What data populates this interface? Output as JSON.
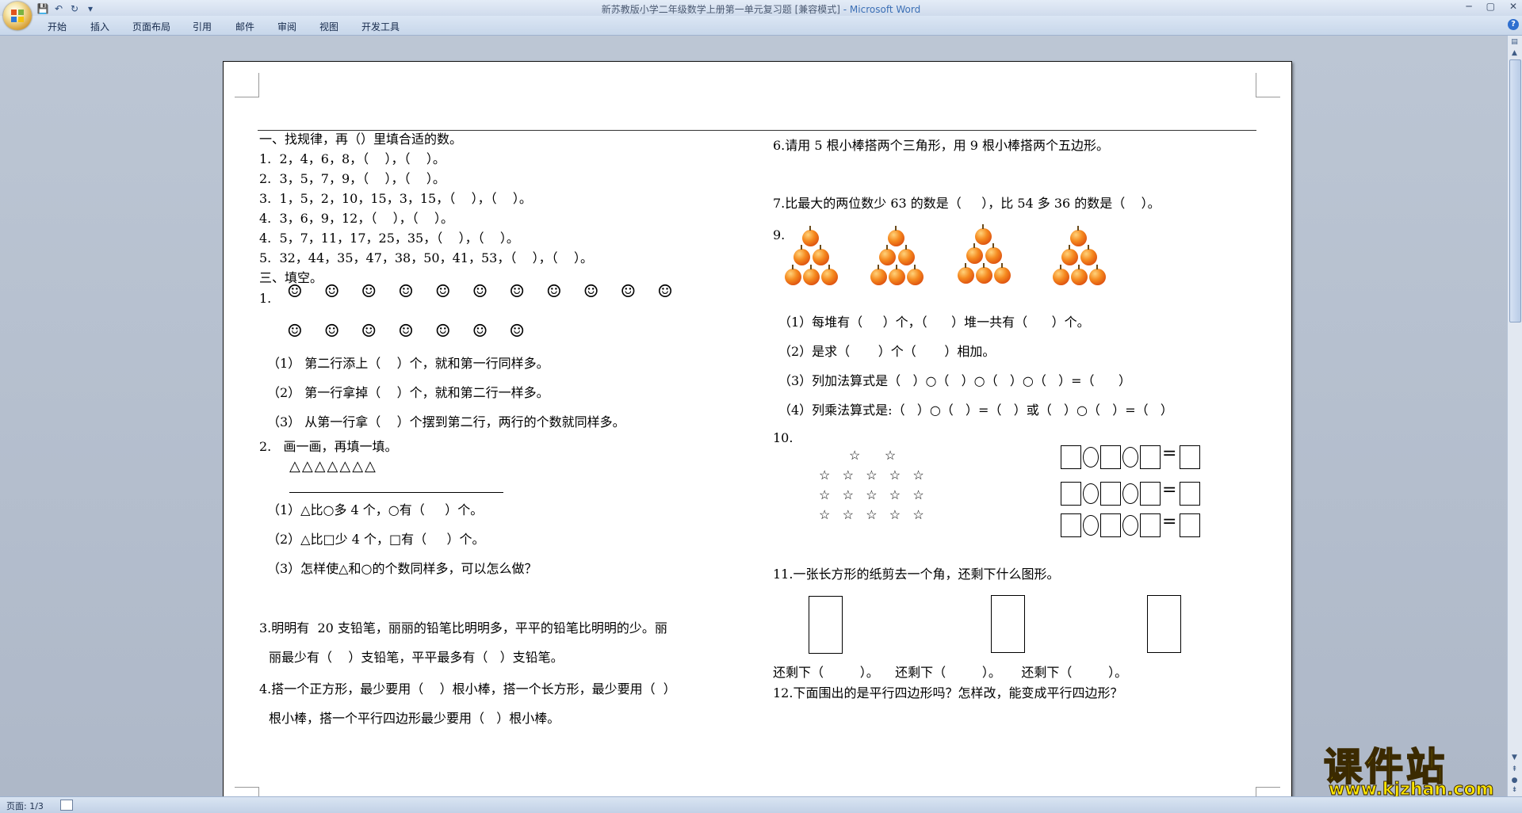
{
  "window": {
    "title": "新苏教版小学二年级数学上册第一单元复习题 [兼容模式]",
    "app_suffix": " - Microsoft Word",
    "controls": [
      "─",
      "▢",
      "✕"
    ]
  },
  "ribbon": {
    "tabs": [
      "开始",
      "插入",
      "页面布局",
      "引用",
      "邮件",
      "审阅",
      "视图",
      "开发工具"
    ],
    "help": "?"
  },
  "status": {
    "page": "页面: 1/3"
  },
  "watermark": {
    "main": "课件站",
    "url": "www.kjzhan.com"
  },
  "doc": {
    "left": {
      "sec1_title": "一、找规律，再（）里填合适的数。",
      "sec1_items": [
        "1.  2，4，6，8，（    ），（    ）。",
        "2.  3，5，7，9，（    ），（    ）。",
        "3.  1，5，2，10，15，3，15，（    ），（    ）。",
        "4.  3，6，9，12，（    ），（    ）。",
        "4.  5，7，11，17，25，35，（    ），（    ）。",
        "5.  32，44，35，47，38，50，41，53，（    ），（    ）。"
      ],
      "sec3_title": "三、填空。",
      "q1_label": "1.",
      "smileys_row1": "☺ ☺ ☺ ☺ ☺ ☺ ☺ ☺ ☺ ☺ ☺",
      "smileys_row2": "☺ ☺ ☺ ☺ ☺ ☺ ☺",
      "q1_sub": [
        "（1） 第二行添上（    ）个，就和第一行同样多。",
        "（2） 第一行拿掉（    ）个，就和第二行一样多。",
        "（3） 从第一行拿（    ）个摆到第二行，两行的个数就同样多。"
      ],
      "q2_title": "2.   画一画，再填一填。",
      "q2_triangles": "△△△△△△△",
      "q2_sub": [
        "（1）△比○多 4 个，○有（     ）个。",
        "（2）△比□少 4 个，□有（     ）个。",
        "（3）怎样使△和○的个数同样多，可以怎么做？"
      ],
      "q3_line1": "3.明明有  20 支铅笔，丽丽的铅笔比明明多，平平的铅笔比明明的少。丽",
      "q3_line2": "丽最少有（    ）支铅笔，平平最多有（   ）支铅笔。",
      "q4_line1": "4.搭一个正方形，最少要用（    ）根小棒，搭一个长方形，最少要用（  ）",
      "q4_line2": "根小棒，搭一个平行四边形最少要用（   ）根小棒。"
    },
    "right": {
      "q6": "6.请用 5 根小棒搭两个三角形，用 9 根小棒搭两个五边形。",
      "q7": "7.比最大的两位数少 63 的数是（     ），比 54 多 36 的数是（    ）。",
      "q9_label": "9.",
      "q9_sub": [
        "（1）每堆有（     ）个，（      ）堆一共有（      ）个。",
        "（2）是求（       ）个（       ）相加。",
        "（3）列加法算式是（   ）○（   ）○（   ）○（   ）=（      ）",
        "（4）列乘法算式是:（   ）○（   ）=（   ）或（   ）○（   ）=（   ）"
      ],
      "q10_label": "10.",
      "q10_star_top": "☆      ☆",
      "q10_star_row": "☆   ☆   ☆   ☆   ☆",
      "q11": "11.一张长方形的纸剪去一个角，还剩下什么图形。",
      "q11_remain": "还剩下（         ）。    还剩下（         ）。     还剩下（         ）。",
      "q12": "12.下面围出的是平行四边形吗？怎样改，能变成平行四边形？"
    }
  }
}
